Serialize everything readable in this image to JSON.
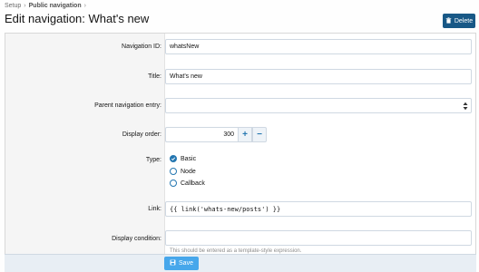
{
  "breadcrumb": {
    "items": [
      "Setup",
      "Public navigation"
    ],
    "separator": "›"
  },
  "page": {
    "title": "Edit navigation: What's new"
  },
  "actions": {
    "delete_label": "Delete",
    "save_label": "Save"
  },
  "form": {
    "navigation_id": {
      "label": "Navigation ID:",
      "value": "whatsNew"
    },
    "title": {
      "label": "Title:",
      "value": "What's new"
    },
    "parent": {
      "label": "Parent navigation entry:",
      "value": ""
    },
    "display_order": {
      "label": "Display order:",
      "value": "300",
      "increment_icon": "+",
      "decrement_icon": "−"
    },
    "type": {
      "label": "Type:",
      "options": [
        {
          "label": "Basic",
          "checked": true
        },
        {
          "label": "Node",
          "checked": false
        },
        {
          "label": "Callback",
          "checked": false
        }
      ]
    },
    "link": {
      "label": "Link:",
      "value": "{{ link('whats-new/posts') }}"
    },
    "display_condition": {
      "label": "Display condition:",
      "value": "",
      "hint": "This should be entered as a template-style expression."
    }
  },
  "colors": {
    "primary": "#185886",
    "accent": "#2577b1",
    "save": "#47a7eb",
    "label_bg": "#f5f5f5"
  },
  "icons": {
    "delete": "trash-icon",
    "save": "save-icon",
    "select": "select-arrows-icon",
    "checked": "check-icon"
  }
}
